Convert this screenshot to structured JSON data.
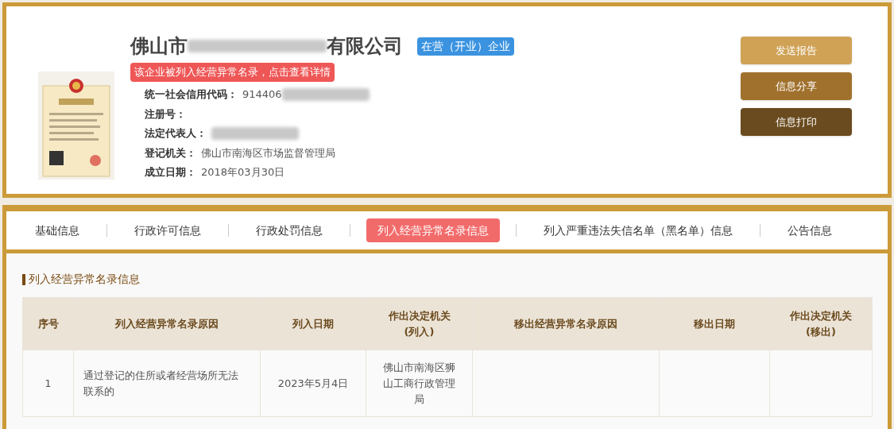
{
  "company": {
    "name_prefix": "佛山市",
    "name_suffix": "有限公司",
    "status_badge": "在营（开业）企业",
    "warning": "该企业被列入经营异常名录，点击查看详情",
    "fields": [
      {
        "label": "统一社会信用代码：",
        "value": "914406",
        "redacted": true
      },
      {
        "label": "注册号：",
        "redacted": false
      },
      {
        "label": "法定代表人：",
        "redacted": true
      },
      {
        "label": "登记机关：",
        "value": "佛山市南海区市场监督管理局",
        "redacted": false
      },
      {
        "label": "成立日期：",
        "value": "2018年03月30日",
        "redacted": false
      }
    ]
  },
  "actions": [
    {
      "label": "发送报告",
      "color": "#cfa256"
    },
    {
      "label": "信息分享",
      "color": "#a0712d"
    },
    {
      "label": "信息打印",
      "color": "#6a4b1f"
    }
  ],
  "tabs": [
    {
      "label": "基础信息",
      "selected": false
    },
    {
      "label": "行政许可信息",
      "selected": false
    },
    {
      "label": "行政处罚信息",
      "selected": false
    },
    {
      "label": "列入经营异常名录信息",
      "selected": true
    },
    {
      "label": "列入严重违法失信名单（黑名单）信息",
      "selected": false
    },
    {
      "label": "公告信息",
      "selected": false
    }
  ],
  "section_title": "列入经营异常名录信息",
  "table": {
    "columns": [
      "序号",
      "列入经营异常名录原因",
      "列入日期",
      "作出决定机关\n(列入)",
      "移出经营异常名录原因",
      "移出日期",
      "作出决定机关\n(移出)"
    ],
    "rows": [
      [
        "1",
        "通过登记的住所或者经营场所无法联系的",
        "2023年5月4日",
        "佛山市南海区狮山工商行政管理局",
        "",
        "",
        ""
      ]
    ]
  }
}
